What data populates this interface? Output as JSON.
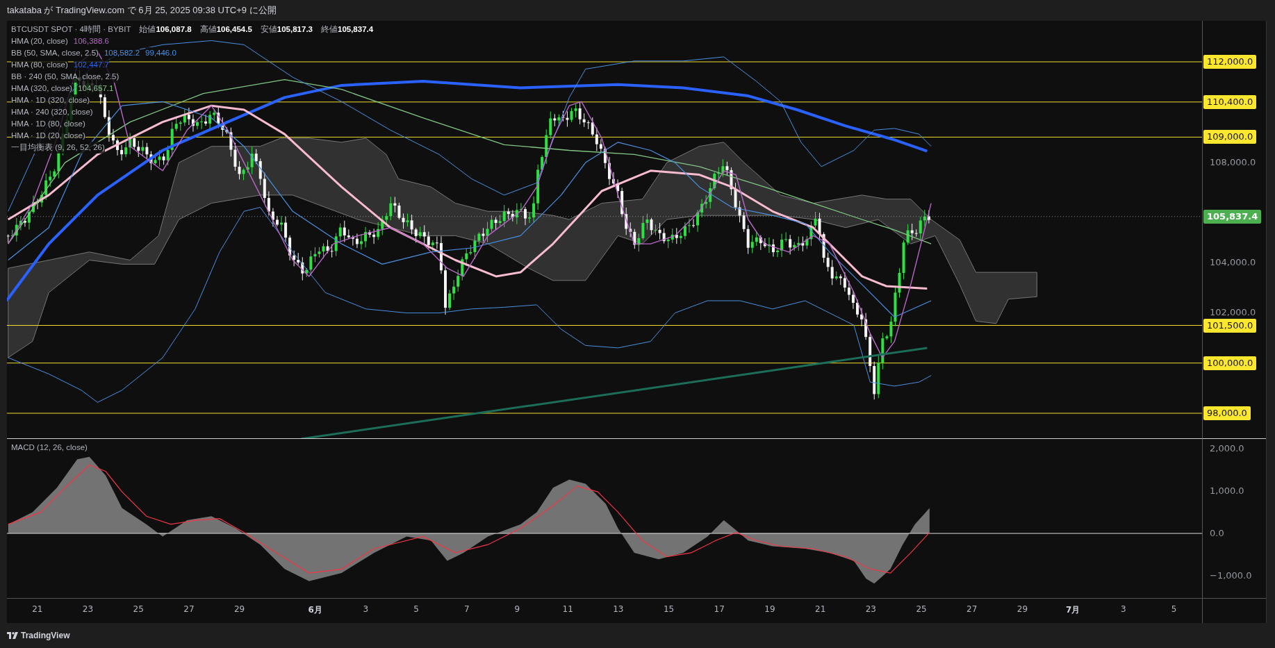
{
  "header": {
    "text": "takataba が TradingView.com で 6月 25, 2025 09:38 UTC+9 に公開"
  },
  "legend": {
    "symbol": "BTCUSDT SPOT · 4時間 · BYBIT",
    "ohlc": [
      {
        "label": "始値",
        "value": "106,087.8"
      },
      {
        "label": "高値",
        "value": "106,454.5"
      },
      {
        "label": "安値",
        "value": "105,817.3"
      },
      {
        "label": "終値",
        "value": "105,837.4"
      }
    ],
    "indicators": [
      {
        "name": "HMA (20, close)",
        "values": [
          "106,388.6"
        ],
        "color": "#b667c8"
      },
      {
        "name": "BB (50, SMA, close, 2.5)",
        "values": [
          "108,582.2",
          "99,446.0"
        ],
        "color": "#4a90e2"
      },
      {
        "name": "HMA (80, close)",
        "values": [
          "102,447.7"
        ],
        "color": "#2962ff"
      },
      {
        "name": "BB · 240 (50, SMA, close, 2.5)"
      },
      {
        "name": "HMA (320, close)",
        "values": [
          "104,657.1"
        ],
        "color": "#81c784"
      },
      {
        "name": "HMA · 1D (320, close)"
      },
      {
        "name": "HMA · 240 (320, close)"
      },
      {
        "name": "HMA · 1D (80, close)"
      },
      {
        "name": "HMA · 1D (20, close)"
      },
      {
        "name": "一目均衡表 (9, 26, 52, 26)"
      }
    ]
  },
  "price_axis": {
    "ticks": [
      "108,000.0",
      "104,000.0",
      "102,000.0"
    ],
    "levels": [
      "112,000.0",
      "110,400.0",
      "109,000.0",
      "101,500.0",
      "100,000.0",
      "98,000.0"
    ],
    "last_price": "105,837.4"
  },
  "macd": {
    "title": "MACD (12, 26, close)",
    "ticks": [
      "2,000.0",
      "1,000.0",
      "0.0",
      "−1,000.0"
    ]
  },
  "time_axis": {
    "labels": [
      {
        "text": "21",
        "kind": "day"
      },
      {
        "text": "23",
        "kind": "day"
      },
      {
        "text": "25",
        "kind": "day"
      },
      {
        "text": "27",
        "kind": "day"
      },
      {
        "text": "29",
        "kind": "day"
      },
      {
        "text": "6月",
        "kind": "month"
      },
      {
        "text": "3",
        "kind": "day"
      },
      {
        "text": "5",
        "kind": "day"
      },
      {
        "text": "7",
        "kind": "day"
      },
      {
        "text": "9",
        "kind": "day"
      },
      {
        "text": "11",
        "kind": "day"
      },
      {
        "text": "13",
        "kind": "day"
      },
      {
        "text": "15",
        "kind": "day"
      },
      {
        "text": "17",
        "kind": "day"
      },
      {
        "text": "19",
        "kind": "day"
      },
      {
        "text": "21",
        "kind": "day"
      },
      {
        "text": "23",
        "kind": "day"
      },
      {
        "text": "25",
        "kind": "day"
      },
      {
        "text": "27",
        "kind": "day"
      },
      {
        "text": "29",
        "kind": "day"
      },
      {
        "text": "7月",
        "kind": "month"
      },
      {
        "text": "3",
        "kind": "day"
      },
      {
        "text": "5",
        "kind": "day"
      }
    ]
  },
  "footer": {
    "brand": "TradingView"
  }
}
